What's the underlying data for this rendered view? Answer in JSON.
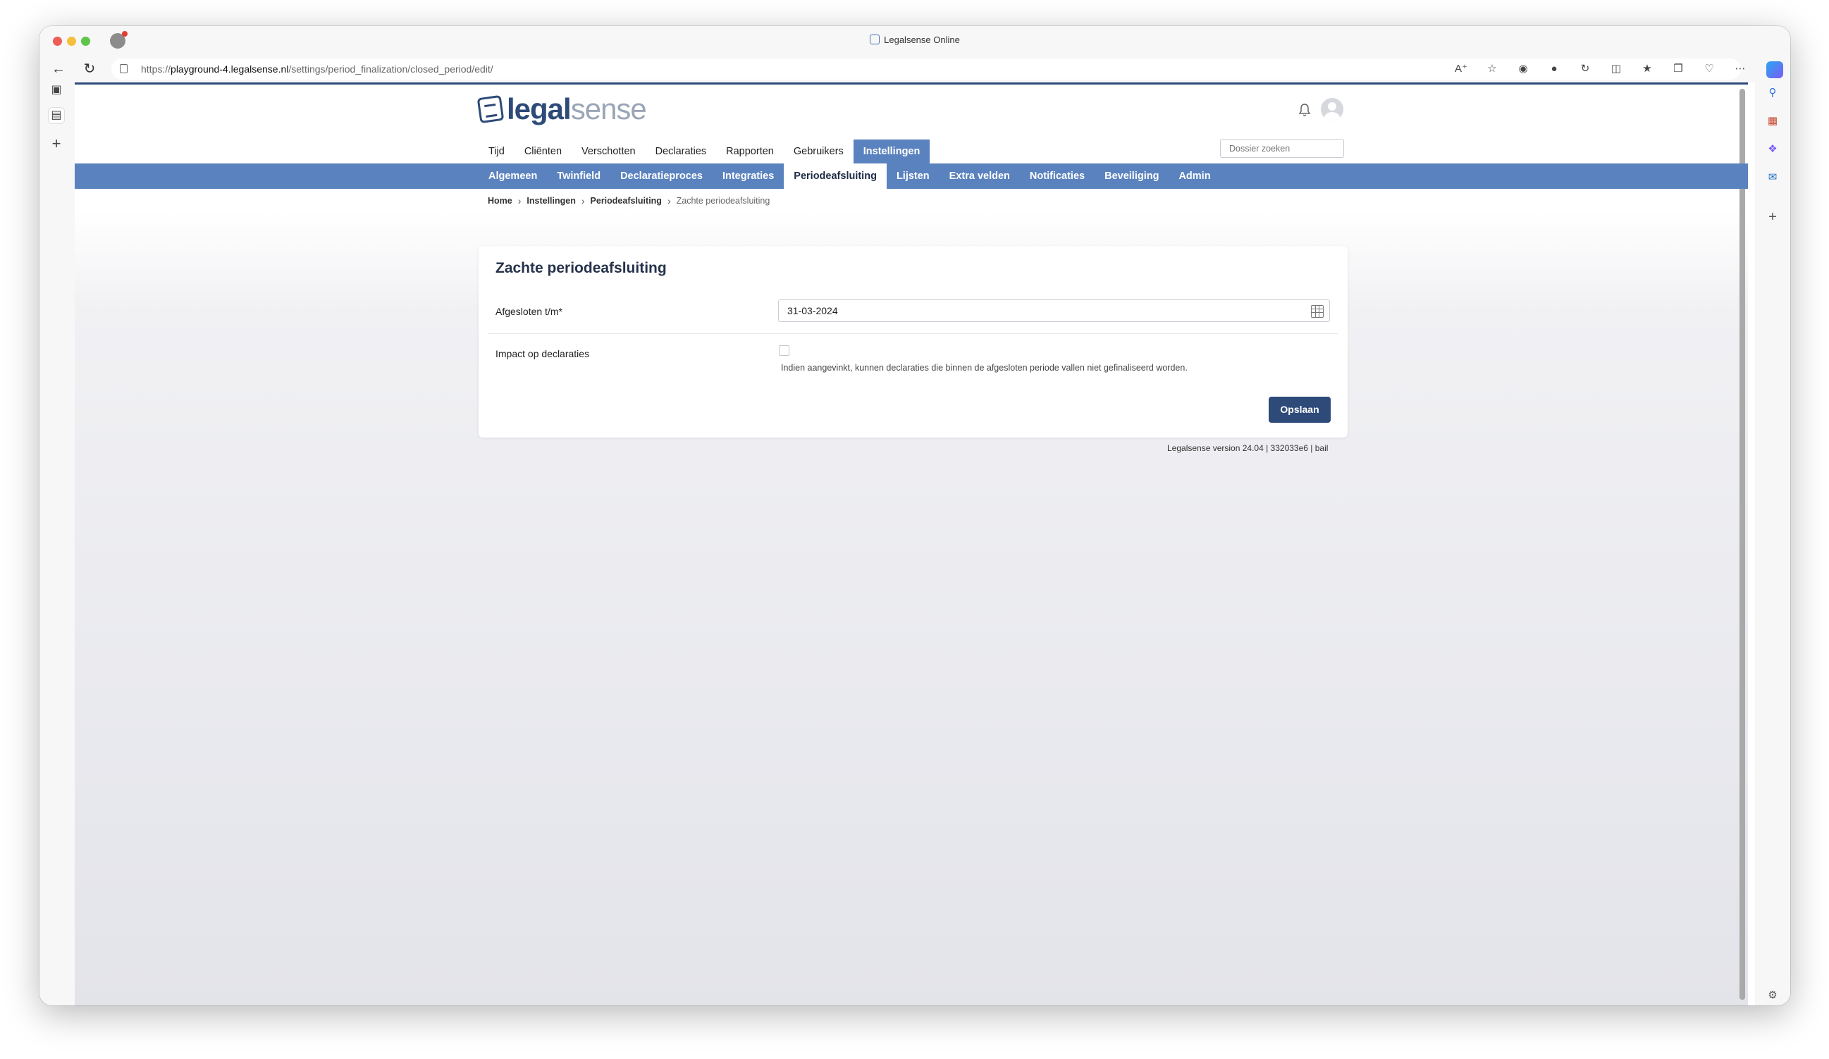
{
  "browser": {
    "window_title": "Legalsense Online",
    "url_scheme": "https://",
    "url_host": "playground-4.legalsense.nl",
    "url_path": "/settings/period_finalization/closed_period/edit/"
  },
  "app": {
    "logo_bold": "legal",
    "logo_light": "sense",
    "dossier_search_placeholder": "Dossier zoeken",
    "main_nav": [
      "Tijd",
      "Cliënten",
      "Verschotten",
      "Declaraties",
      "Rapporten",
      "Gebruikers",
      "Instellingen"
    ],
    "main_nav_active": "Instellingen",
    "sub_nav": [
      "Algemeen",
      "Twinfield",
      "Declaratieproces",
      "Integraties",
      "Periodeafsluiting",
      "Lijsten",
      "Extra velden",
      "Notificaties",
      "Beveiliging",
      "Admin"
    ],
    "sub_nav_active": "Periodeafsluiting",
    "accent_color": "#5a82bf",
    "primary_color": "#2d4a78"
  },
  "breadcrumb": {
    "items": [
      "Home",
      "Instellingen",
      "Periodeafsluiting"
    ],
    "current": "Zachte periodeafsluiting"
  },
  "form": {
    "title": "Zachte periodeafsluiting",
    "closed_until_label": "Afgesloten t/m*",
    "closed_until_value": "31-03-2024",
    "impact_label": "Impact op declaraties",
    "impact_checked": false,
    "impact_help": "Indien aangevinkt, kunnen declaraties die binnen de afgesloten periode vallen niet gefinaliseerd worden.",
    "save_label": "Opslaan"
  },
  "footer": {
    "version": "Legalsense version 24.04 | 332033e6 | bail"
  }
}
